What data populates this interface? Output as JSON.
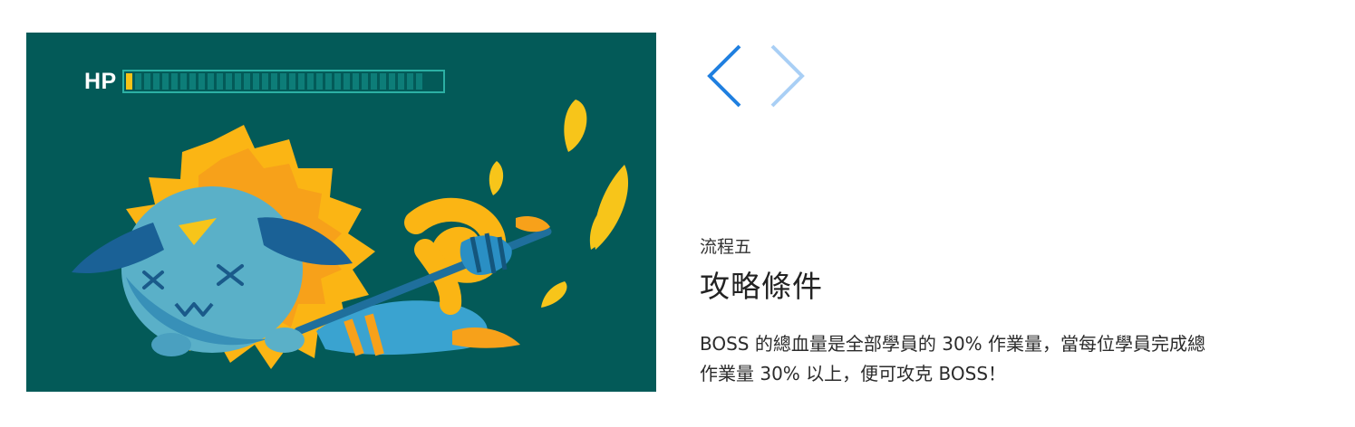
{
  "hp": {
    "label": "HP",
    "segments": 33,
    "filled_segments": 1,
    "colors": {
      "fill": "#f7c318",
      "empty": "#0d7d78",
      "border": "#2cb0a4"
    }
  },
  "illustration": {
    "background": "#035a58",
    "subject": "defeated-blue-lion-monster-icon"
  },
  "nav": {
    "prev_icon": "chevron-left-icon",
    "next_icon": "chevron-right-icon",
    "prev_color": "#1f7fe0",
    "next_color": "#a9cff5"
  },
  "step": {
    "label": "流程五",
    "title": "攻略條件",
    "description_lines": [
      "BOSS 的總血量是全部學員的 30% 作業量，當每位學員完成總",
      "作業量 30% 以上，便可攻克 BOSS！"
    ]
  }
}
